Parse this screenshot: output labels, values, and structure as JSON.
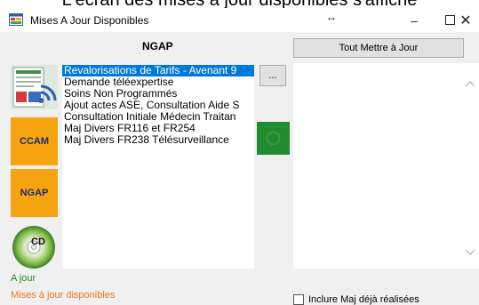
{
  "caption": "L'écran des mises à jour disponibles s'affiche",
  "window": {
    "title": "Mises A Jour Disponibles",
    "resize_glyph": "↔",
    "minimize_glyph": "–",
    "close_glyph": "✕"
  },
  "header": {
    "ngap_label": "NGAP",
    "tout_mettre_label": "Tout Mettre à Jour"
  },
  "sidebar": {
    "ccam_label": "CCAM",
    "ngap_label": "NGAP",
    "cd_label": "CD"
  },
  "updates": {
    "items": [
      "Revalorisations de Tarifs - Avenant 9",
      "Demande téléexpertise",
      "Soins Non Programmés",
      "Ajout actes ASE, Consultation Aide S",
      "Consultation Initiale Médecin Traitan",
      "Maj Divers FR116 et FR254",
      "Maj Divers FR238 Télésurveillance"
    ],
    "selected_index": 0
  },
  "buttons": {
    "dots_label": "..."
  },
  "status": {
    "a_jour": "A jour",
    "maj_disponibles": "Mises à jour disponibles"
  },
  "options": {
    "inclure_label": "Inclure Maj déjà réalisées",
    "inclure_checked": false
  },
  "colors": {
    "selection": "#0078d7",
    "tile_orange": "#f5a30f",
    "tile_text": "#1a2e6e",
    "green_button": "#1f8c2f",
    "status_green": "#1e8a1e",
    "status_orange": "#e8761d"
  },
  "icons": {
    "app": "app-window-icon",
    "rss": "rss-document-icon",
    "cd": "cd-disc-icon",
    "refresh": "refresh-icon",
    "scroll_up": "chevron-up-icon",
    "scroll_down": "chevron-down-icon"
  }
}
